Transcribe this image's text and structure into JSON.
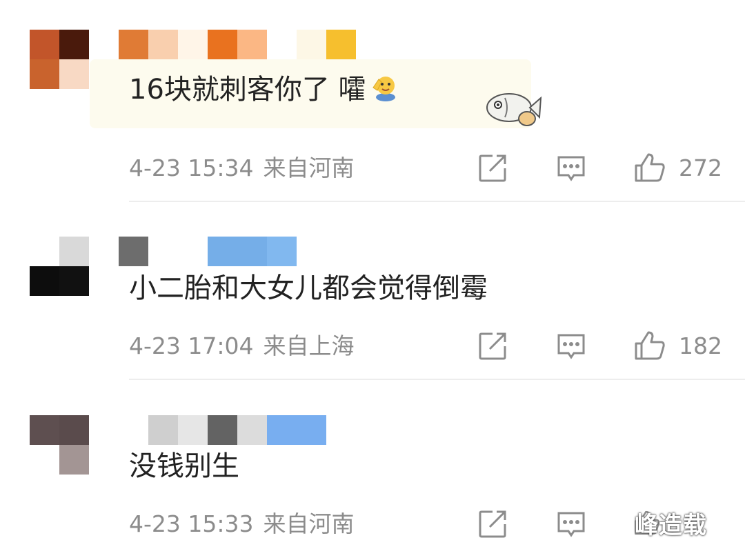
{
  "colors": {
    "text": "#222222",
    "meta": "#8c8c8c",
    "divider": "#ededed"
  },
  "comments": [
    {
      "text": "16块就刺客你了 嚯",
      "reaction_icon": "salute-face-emoji",
      "sticker": "fish-sticker",
      "time": "4-23 15:34",
      "location": "来自河南",
      "likes": "272"
    },
    {
      "text": "小二胎和大女儿都会觉得倒霉",
      "time": "4-23 17:04",
      "location": "来自上海",
      "likes": "182"
    },
    {
      "text": "没钱别生",
      "time": "4-23 15:33",
      "location": "来自河南",
      "likes": ""
    }
  ],
  "icons": {
    "share": "share-icon",
    "reply": "comment-icon",
    "like": "thumbs-up-icon"
  },
  "watermark": "峰造载"
}
